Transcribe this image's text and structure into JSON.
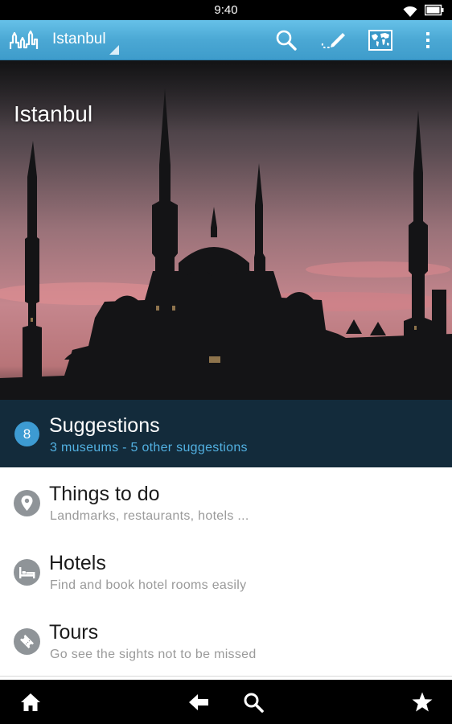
{
  "status_bar": {
    "time": "9:40"
  },
  "action_bar": {
    "city": "Istanbul",
    "icons": [
      "app-logo-icon",
      "search-icon",
      "edit-route-icon",
      "world-map-icon",
      "overflow-menu-icon"
    ]
  },
  "hero": {
    "title": "Istanbul"
  },
  "suggestions": {
    "count": "8",
    "title": "Suggestions",
    "subtitle": "3 museums - 5 other suggestions"
  },
  "list": [
    {
      "title": "Things to do",
      "subtitle": "Landmarks, restaurants, hotels ...",
      "icon": "map-pin-icon"
    },
    {
      "title": "Hotels",
      "subtitle": "Find and book hotel rooms easily",
      "icon": "bed-icon"
    },
    {
      "title": "Tours",
      "subtitle": "Go see the sights not to be missed",
      "icon": "ticket-icon"
    }
  ],
  "bottom_nav": {
    "icons": [
      "home-icon",
      "back-arrow-icon",
      "search-icon",
      "star-icon"
    ]
  },
  "colors": {
    "action_bar": "#4ba8d4",
    "suggestions_bg": "#132b3b",
    "suggestions_subtitle": "#52b1e2",
    "badge": "#3d9bd2",
    "row_icon": "#8f9498"
  }
}
